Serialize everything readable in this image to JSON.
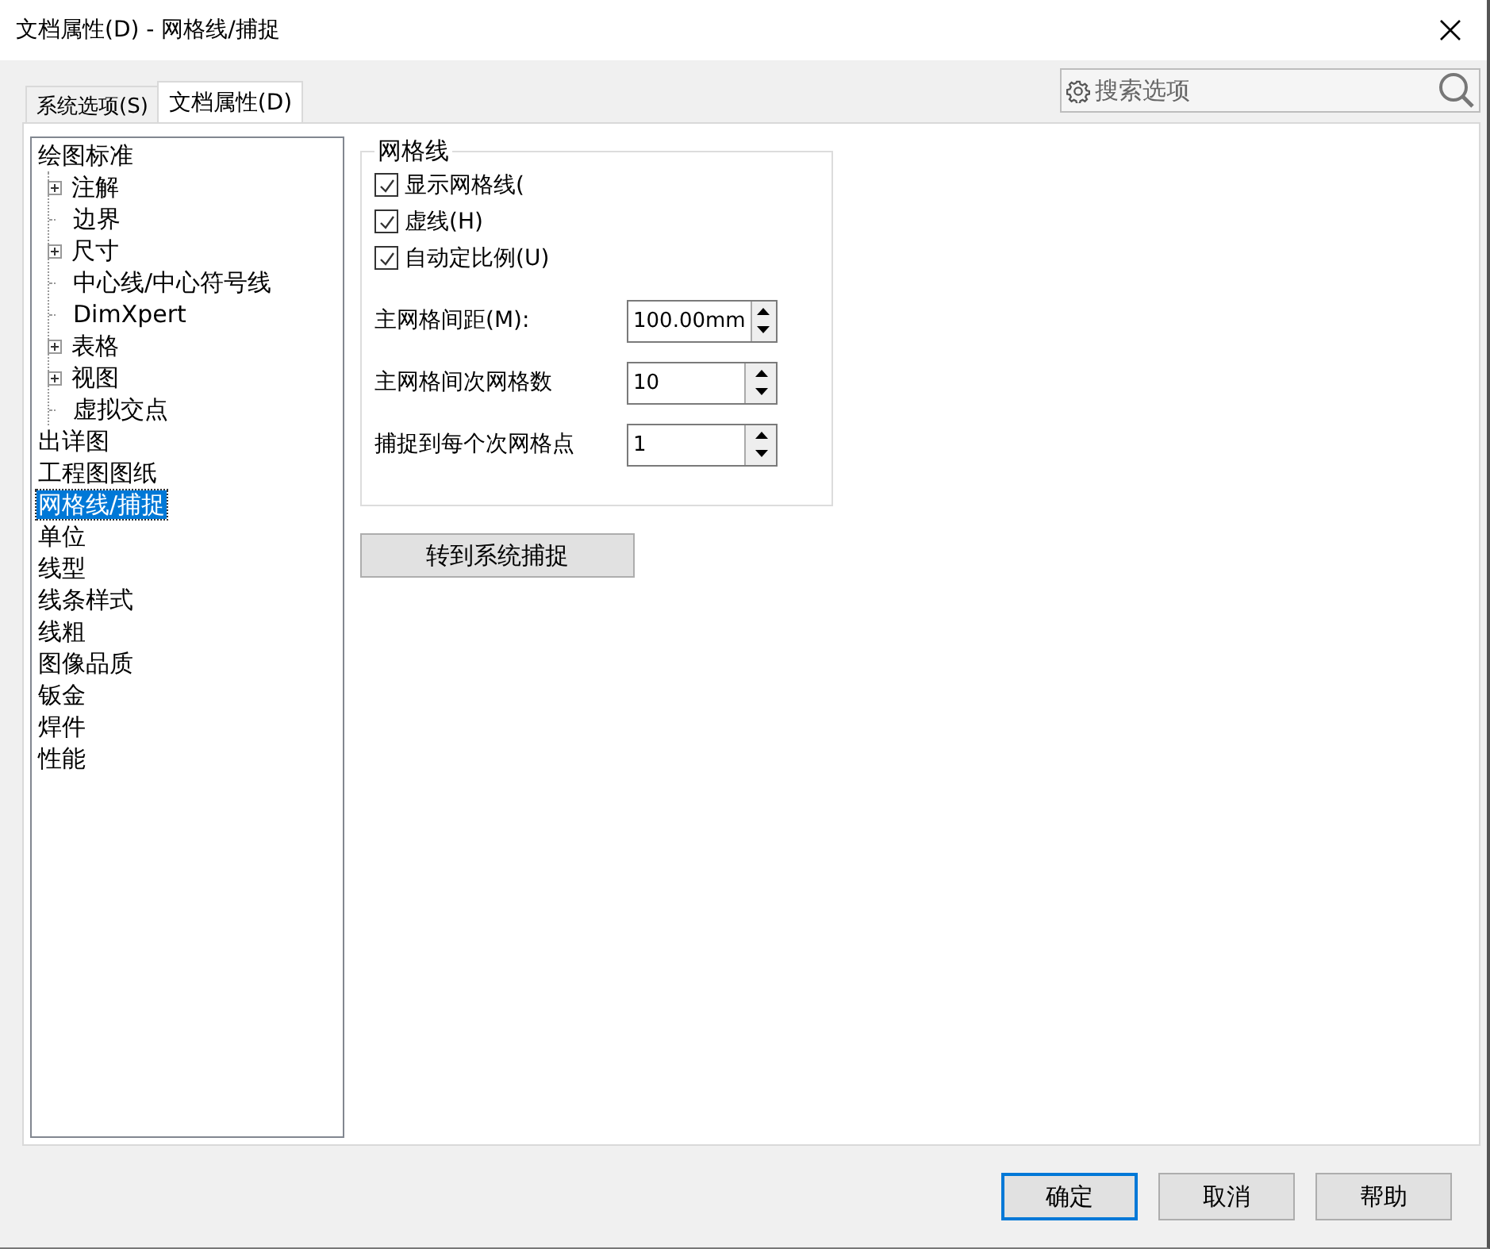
{
  "window": {
    "title": "文档属性(D) - 网格线/捕捉"
  },
  "tabs": [
    {
      "label": "系统选项(S)",
      "selected": false
    },
    {
      "label": "文档属性(D)",
      "selected": true
    }
  ],
  "search": {
    "placeholder": "搜索选项"
  },
  "tree": [
    {
      "label": "绘图标准",
      "selected": false,
      "children": [
        {
          "label": "注解",
          "selected": false,
          "has_children": true
        },
        {
          "label": "边界",
          "selected": false,
          "has_children": false
        },
        {
          "label": "尺寸",
          "selected": false,
          "has_children": true
        },
        {
          "label": "中心线/中心符号线",
          "selected": false,
          "has_children": false
        },
        {
          "label": "DimXpert",
          "selected": false,
          "has_children": false
        },
        {
          "label": "表格",
          "selected": false,
          "has_children": true
        },
        {
          "label": "视图",
          "selected": false,
          "has_children": true
        },
        {
          "label": "虚拟交点",
          "selected": false,
          "has_children": false
        }
      ]
    },
    {
      "label": "出详图",
      "selected": false
    },
    {
      "label": "工程图图纸",
      "selected": false
    },
    {
      "label": "网格线/捕捉",
      "selected": true
    },
    {
      "label": "单位",
      "selected": false
    },
    {
      "label": "线型",
      "selected": false
    },
    {
      "label": "线条样式",
      "selected": false
    },
    {
      "label": "线粗",
      "selected": false
    },
    {
      "label": "图像品质",
      "selected": false
    },
    {
      "label": "钣金",
      "selected": false
    },
    {
      "label": "焊件",
      "selected": false
    },
    {
      "label": "性能",
      "selected": false
    }
  ],
  "group": {
    "title": "网格线",
    "checkboxes": [
      {
        "label": "显示网格线(",
        "checked": true
      },
      {
        "label": "虚线(H)",
        "checked": true
      },
      {
        "label": "自动定比例(U)",
        "checked": true
      }
    ],
    "spinners": [
      {
        "label": "主网格间距(M):",
        "value": "100.00mm"
      },
      {
        "label": "主网格间次网格数",
        "value": "10"
      },
      {
        "label": "捕捉到每个次网格点",
        "value": "1"
      }
    ]
  },
  "action_button": "转到系统捕捉",
  "buttons": [
    {
      "label": "确定",
      "selected": true
    },
    {
      "label": "取消",
      "selected": false
    },
    {
      "label": "帮助",
      "selected": false
    }
  ]
}
